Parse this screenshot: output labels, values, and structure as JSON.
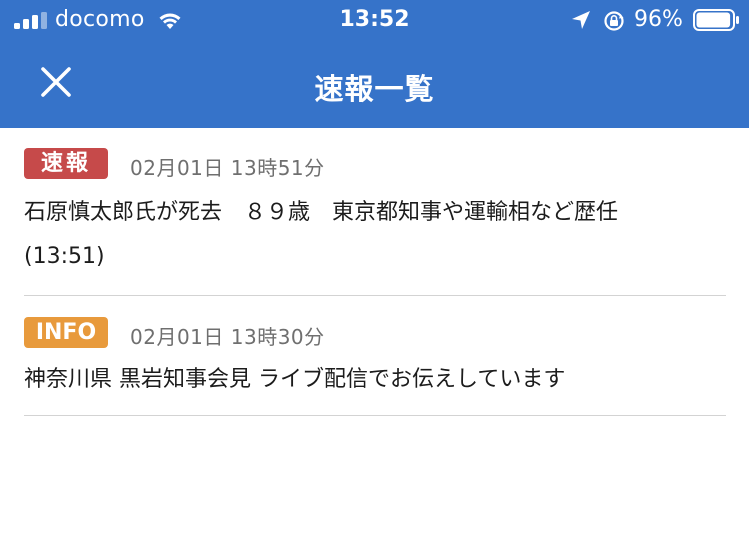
{
  "status_bar": {
    "carrier": "docomo",
    "time": "13:52",
    "battery_percent": "96%",
    "battery_level": 0.96,
    "icons": [
      "signal-bars-icon",
      "wifi-icon",
      "location-arrow-icon",
      "rotation-lock-icon",
      "battery-icon"
    ]
  },
  "nav": {
    "title": "速報一覧",
    "close_icon": "close-icon"
  },
  "colors": {
    "header_bg": "#3673c9",
    "badge_breaking": "#c64a4a",
    "badge_info": "#e89a3c",
    "divider": "#d3d3d3"
  },
  "items": [
    {
      "badge": "速報",
      "badge_type": "breaking",
      "timestamp": "02月01日 13時51分",
      "headline": "石原慎太郎氏が死去　８９歳　東京都知事や運輸相など歴任",
      "headline_time": "(13:51)"
    },
    {
      "badge": "INFO",
      "badge_type": "info",
      "timestamp": "02月01日 13時30分",
      "headline": "神奈川県 黒岩知事会見 ライブ配信でお伝えしています"
    }
  ]
}
